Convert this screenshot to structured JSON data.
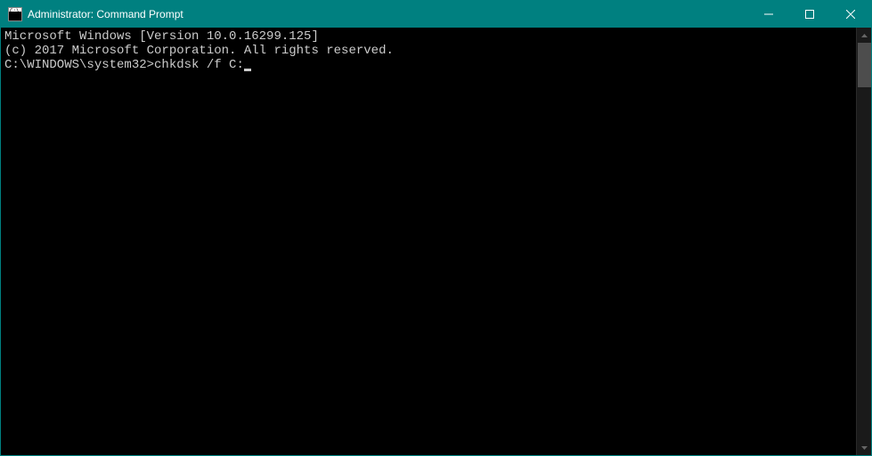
{
  "titlebar": {
    "title": "Administrator: Command Prompt",
    "icon_name": "cmd-icon"
  },
  "console": {
    "line1": "Microsoft Windows [Version 10.0.16299.125]",
    "line2": "(c) 2017 Microsoft Corporation. All rights reserved.",
    "blank": "",
    "prompt": "C:\\WINDOWS\\system32>",
    "command": "chkdsk /f C:"
  },
  "colors": {
    "titlebar_bg": "#008080",
    "console_bg": "#000000",
    "console_fg": "#cccccc"
  }
}
